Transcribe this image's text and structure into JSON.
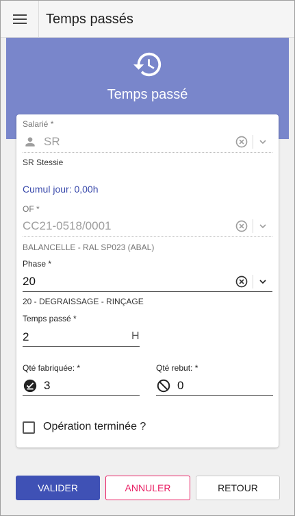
{
  "topbar": {
    "title": "Temps passés"
  },
  "hero": {
    "title": "Temps passé",
    "icon": "history-icon"
  },
  "form": {
    "salarie": {
      "label": "Salarié *",
      "value": "SR",
      "hint": "SR  Stessie"
    },
    "cumul": "Cumul jour: 0,00h",
    "of": {
      "label": "OF *",
      "value": "CC21-0518/0001",
      "hint": "BALANCELLE - RAL SP023 (ABAL)"
    },
    "phase": {
      "label": "Phase *",
      "value": "20",
      "hint": "20 - DEGRAISSAGE - RINÇAGE"
    },
    "temps": {
      "label": "Temps passé *",
      "value": "2",
      "suffix": "H"
    },
    "qte_fab": {
      "label": "Qté fabriquée: *",
      "value": "3"
    },
    "qte_rebut": {
      "label": "Qté rebut: *",
      "value": "0"
    },
    "operation_terminee": {
      "label": "Opération terminée ?",
      "checked": false
    }
  },
  "buttons": {
    "valider": "VALIDER",
    "annuler": "ANNULER",
    "retour": "RETOUR"
  },
  "colors": {
    "hero": "#7986cb",
    "primary": "#3f51b5",
    "warn": "#e91e63",
    "link": "#3949ab"
  }
}
